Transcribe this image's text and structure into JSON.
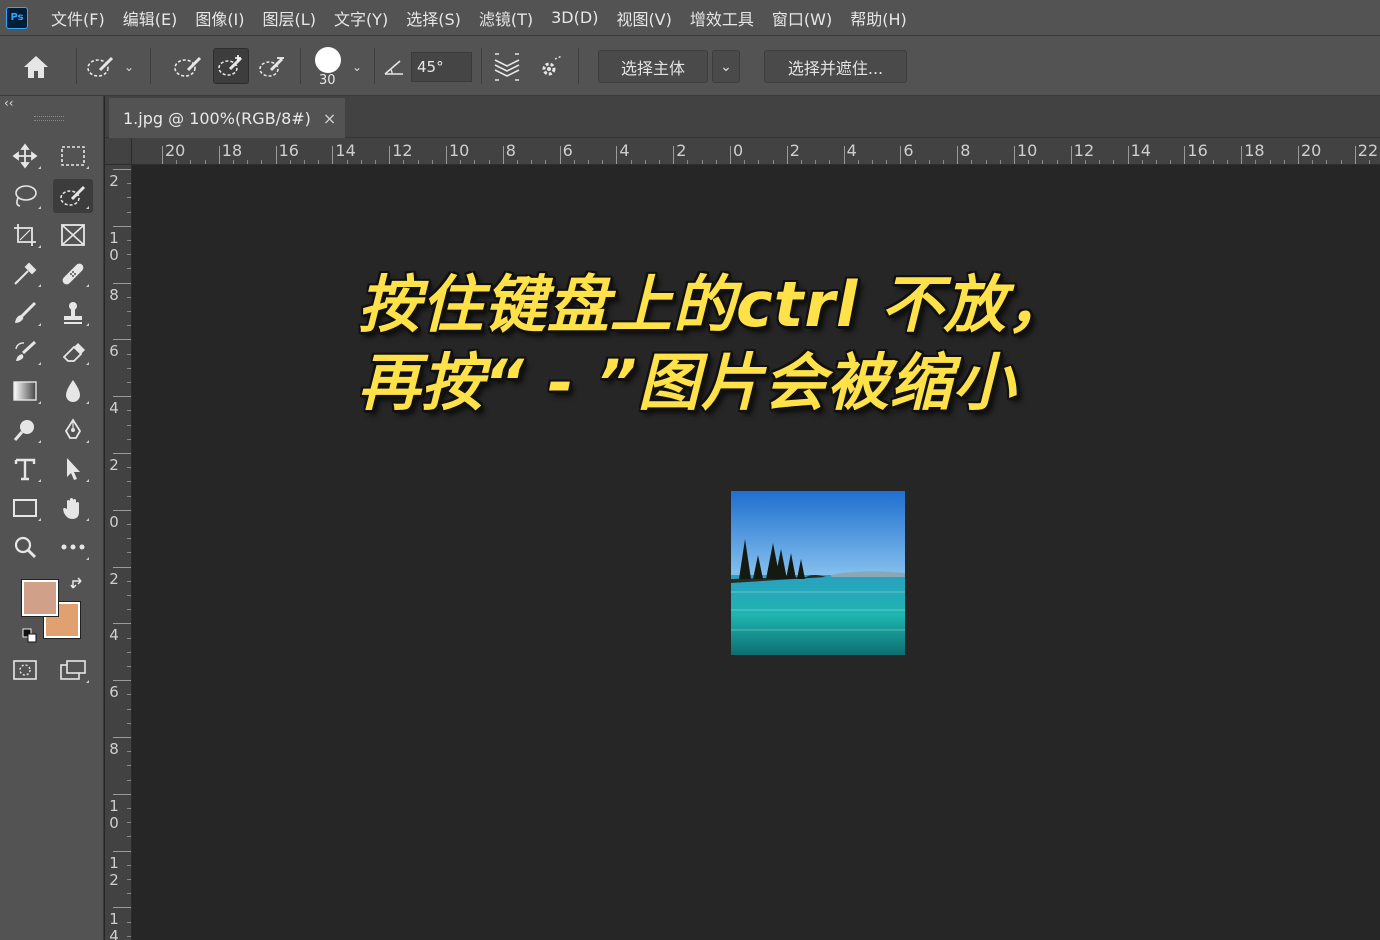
{
  "app": {
    "logo_text": "Ps"
  },
  "menu": [
    "文件(F)",
    "编辑(E)",
    "图像(I)",
    "图层(L)",
    "文字(Y)",
    "选择(S)",
    "滤镜(T)",
    "3D(D)",
    "视图(V)",
    "增效工具",
    "窗口(W)",
    "帮助(H)"
  ],
  "options": {
    "brush_size": "30",
    "angle": "45°",
    "select_subject_label": "选择主体",
    "select_and_mask_label": "选择并遮住..."
  },
  "toolbox": {
    "collapse_label": "‹‹",
    "foreground_color": "#d0a088",
    "background_color": "#e0a070"
  },
  "document": {
    "tab_title": "1.jpg @ 100%(RGB/8#)",
    "close_glyph": "×"
  },
  "ruler": {
    "horizontal": [
      "20",
      "18",
      "16",
      "14",
      "12",
      "10",
      "8",
      "6",
      "4",
      "2",
      "0",
      "2",
      "4",
      "6",
      "8",
      "10",
      "12",
      "14",
      "16",
      "18",
      "20",
      "22"
    ],
    "vertical": [
      "2",
      "10",
      "8",
      "6",
      "4",
      "2",
      "0",
      "2",
      "4",
      "6",
      "8",
      "10",
      "12",
      "14"
    ]
  },
  "caption": {
    "line1": "按住键盘上的ctrl 不放，",
    "line2": "再按“ - ”图片会被缩小",
    "color": "#ffe14a"
  }
}
